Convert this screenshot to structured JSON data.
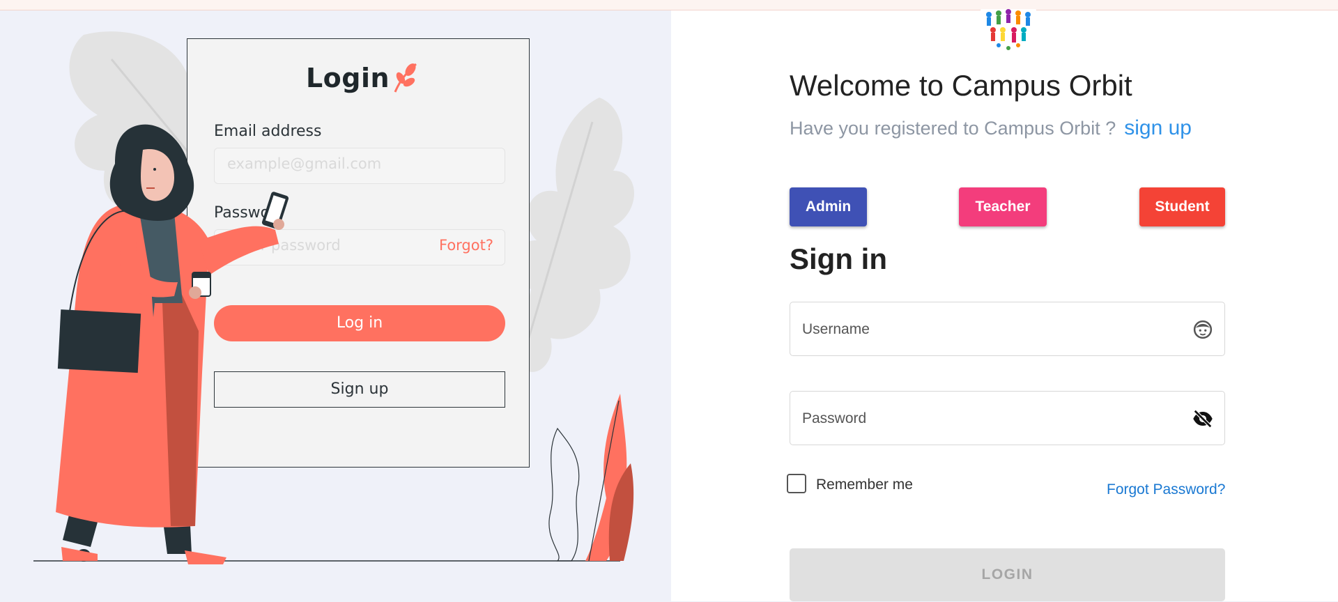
{
  "illustration": {
    "login_title": "Login",
    "email_label": "Email address",
    "email_placeholder": "example@gmail.com",
    "password_label": "Passwo",
    "password_placeholder": "Enter password",
    "forgot_link": "Forgot?",
    "login_button": "Log in",
    "signup_button": "Sign up"
  },
  "header": {
    "logo_icon": "people-globe-icon",
    "welcome_title": "Welcome to Campus Orbit",
    "subtitle": "Have you registered to Campus Orbit ?",
    "signup_link": "sign up"
  },
  "roles": {
    "admin": "Admin",
    "teacher": "Teacher",
    "student": "Student"
  },
  "form": {
    "title": "Sign in",
    "username_placeholder": "Username",
    "username_icon": "face-icon",
    "password_placeholder": "Password",
    "password_icon": "eye-off-icon",
    "remember_label": "Remember me",
    "forgot_password": "Forgot Password?",
    "login_button": "LOGIN"
  },
  "colors": {
    "admin": "#3f51b5",
    "teacher": "#f33d7c",
    "student": "#f44336",
    "link": "#2f92e8",
    "illustration_accent": "#ff7160"
  }
}
